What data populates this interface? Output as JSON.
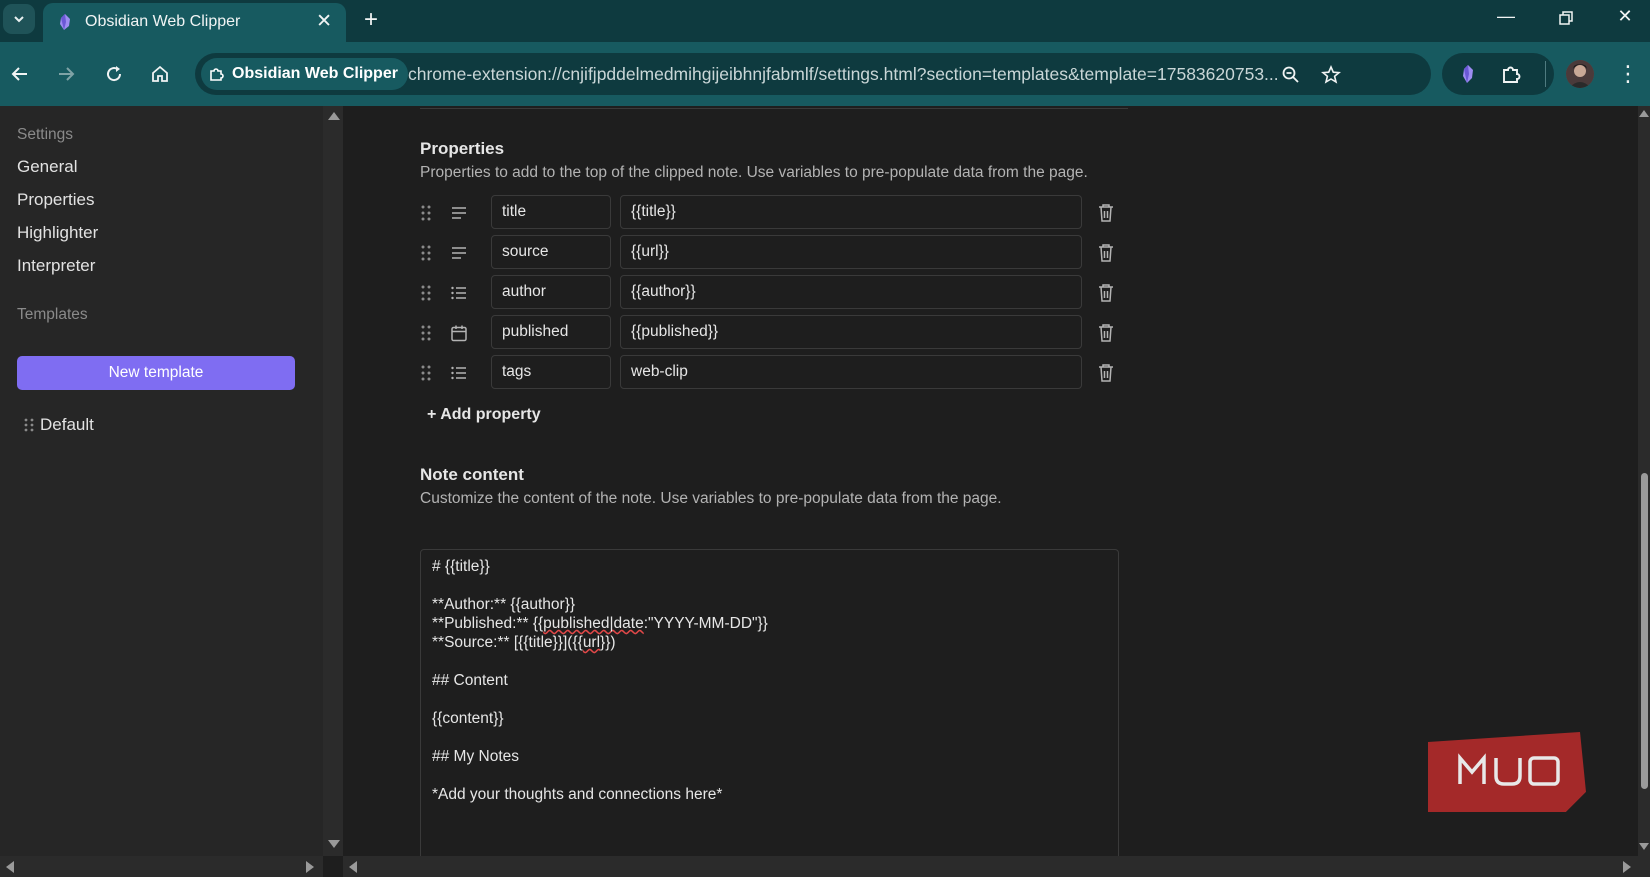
{
  "browser": {
    "tab": {
      "title": "Obsidian Web Clipper"
    },
    "omnibox": {
      "extension_name": "Obsidian Web Clipper",
      "url": "chrome-extension://cnjifjpddelmedmihgijeibhnjfabmlf/settings.html?section=templates&template=17583620753..."
    },
    "colors": {
      "frame": "#0e3a3f",
      "toolbar": "#175a60"
    }
  },
  "sidebar": {
    "settings_heading": "Settings",
    "items": [
      {
        "label": "General"
      },
      {
        "label": "Properties"
      },
      {
        "label": "Highlighter"
      },
      {
        "label": "Interpreter"
      }
    ],
    "templates_heading": "Templates",
    "new_template_label": "New template",
    "templates": [
      {
        "label": "Default"
      }
    ],
    "accent_color": "#7f6df2"
  },
  "properties": {
    "title": "Properties",
    "description": "Properties to add to the top of the clipped note. Use variables to pre-populate data from the page.",
    "rows": [
      {
        "type_icon": "text-icon",
        "name": "title",
        "value": "{{title}}"
      },
      {
        "type_icon": "text-icon",
        "name": "source",
        "value": "{{url}}"
      },
      {
        "type_icon": "list-icon",
        "name": "author",
        "value": "{{author}}"
      },
      {
        "type_icon": "calendar-icon",
        "name": "published",
        "value": "{{published}}"
      },
      {
        "type_icon": "list-icon",
        "name": "tags",
        "value": "web-clip"
      }
    ],
    "add_label": "+ Add property"
  },
  "note_content": {
    "title": "Note content",
    "description": "Customize the content of the note. Use variables to pre-populate data from the page.",
    "lines": [
      "# {{title}}",
      "",
      "**Author:** {{author}}",
      "**Published:** {{published|date:\"YYYY-MM-DD\"}}",
      "**Source:** [{{title}}]({{url}})",
      "",
      "## Content",
      "",
      "{{content}}",
      "",
      "## My Notes",
      "",
      "*Add your thoughts and connections here*"
    ]
  },
  "watermark": {
    "text": "MUO",
    "color": "#b22a2a"
  }
}
